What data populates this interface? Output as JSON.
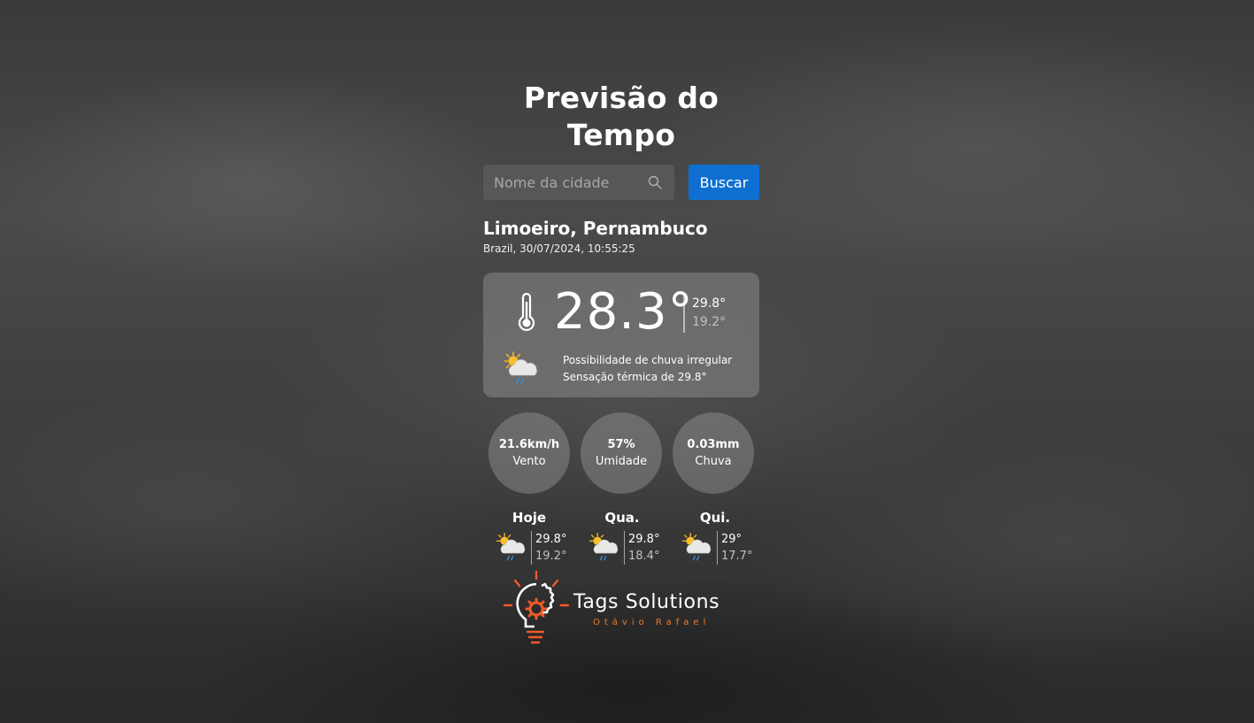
{
  "header": {
    "title": "Previsão do Tempo"
  },
  "search": {
    "placeholder": "Nome da cidade",
    "button_label": "Buscar"
  },
  "location": {
    "city": "Limoeiro, Pernambuco",
    "subtitle": "Brazil, 30/07/2024, 10:55:25"
  },
  "current": {
    "temperature": "28.3°",
    "max": "29.8°",
    "min": "19.2°",
    "condition": "Possibilidade de chuva irregular",
    "feels_like": "Sensação térmica de 29.8°",
    "icon": "partly-cloudy-rain-icon"
  },
  "stats": [
    {
      "value": "21.6km/h",
      "label": "Vento"
    },
    {
      "value": "57%",
      "label": "Umidade"
    },
    {
      "value": "0.03mm",
      "label": "Chuva"
    }
  ],
  "forecast": [
    {
      "day": "Hoje",
      "max": "29.8°",
      "min": "19.2°",
      "icon": "partly-cloudy-rain-icon"
    },
    {
      "day": "Qua.",
      "max": "29.8°",
      "min": "18.4°",
      "icon": "partly-cloudy-rain-icon"
    },
    {
      "day": "Qui.",
      "max": "29°",
      "min": "17.7°",
      "icon": "partly-cloudy-rain-icon"
    }
  ],
  "brand": {
    "name": "Tags Solutions",
    "author": "Otávio Rafael",
    "accent_color": "#f07a2a"
  },
  "colors": {
    "button": "#0e6fd1",
    "card": "rgba(150,150,150,0.45)"
  }
}
